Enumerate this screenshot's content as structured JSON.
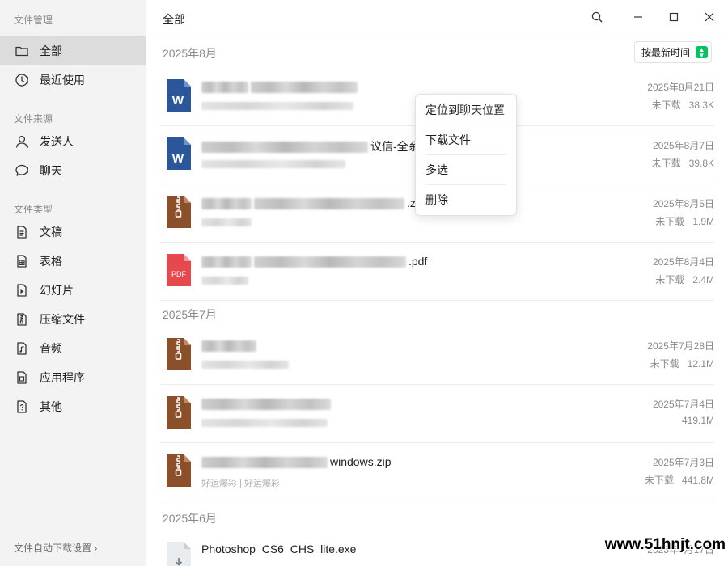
{
  "sidebar": {
    "section_manage": "文件管理",
    "section_source": "文件来源",
    "section_type": "文件类型",
    "items": [
      {
        "label": "全部",
        "icon": "folder-icon"
      },
      {
        "label": "最近使用",
        "icon": "clock-icon"
      },
      {
        "label": "发送人",
        "icon": "person-icon"
      },
      {
        "label": "聊天",
        "icon": "chat-bubble-icon"
      },
      {
        "label": "文稿",
        "icon": "document-icon"
      },
      {
        "label": "表格",
        "icon": "spreadsheet-icon"
      },
      {
        "label": "幻灯片",
        "icon": "slides-icon"
      },
      {
        "label": "压缩文件",
        "icon": "archive-icon"
      },
      {
        "label": "音频",
        "icon": "audio-icon"
      },
      {
        "label": "应用程序",
        "icon": "app-icon"
      },
      {
        "label": "其他",
        "icon": "unknown-file-icon"
      }
    ],
    "footer_link": "文件自动下载设置 ›"
  },
  "header": {
    "title": "全部",
    "search_icon": "search-icon",
    "minimize_icon": "minimize-icon",
    "maximize_icon": "maximize-icon",
    "close_icon": "close-icon"
  },
  "sort_label": "按最新时间",
  "groups": [
    {
      "label": "2025年8月"
    },
    {
      "label": "2025年7月"
    },
    {
      "label": "2025年6月"
    }
  ],
  "files": [
    {
      "type": "word",
      "name_suffix": "",
      "subtitle": "",
      "date": "2025年8月21日",
      "status": "未下载",
      "size": "38.3K"
    },
    {
      "type": "word",
      "name_suffix": "议信-全系",
      "subtitle": "",
      "date": "2025年8月7日",
      "status": "未下载",
      "size": "39.8K"
    },
    {
      "type": "zip",
      "name_suffix": ".z",
      "subtitle": "",
      "date": "2025年8月5日",
      "status": "未下载",
      "size": "1.9M"
    },
    {
      "type": "pdf",
      "name_suffix": ".pdf",
      "subtitle": "",
      "date": "2025年8月4日",
      "status": "未下载",
      "size": "2.4M"
    },
    {
      "type": "zip",
      "name_suffix": "",
      "subtitle": "",
      "date": "2025年7月28日",
      "status": "未下载",
      "size": "12.1M"
    },
    {
      "type": "zip",
      "name_suffix": "",
      "subtitle": "",
      "date": "2025年7月4日",
      "status": "",
      "size": "419.1M"
    },
    {
      "type": "zip",
      "name_suffix": "windows.zip",
      "subtitle": "好运爆彩 | 好运爆彩",
      "date": "2025年7月3日",
      "status": "未下载",
      "size": "441.8M"
    },
    {
      "type": "exe",
      "name_suffix": "Photoshop_CS6_CHS_lite.exe",
      "subtitle": "",
      "date": "2025年6月17日",
      "status": "",
      "size": ""
    }
  ],
  "pdf_badge": "PDF",
  "word_badge": "W",
  "context_menu": {
    "items": [
      "定位到聊天位置",
      "下载文件",
      "多选",
      "删除"
    ]
  },
  "watermark": "www.51hnjt.com",
  "colors": {
    "sidebar_bg": "#f3f3f3",
    "sidebar_active": "#dcdcdc",
    "word_blue": "#2b579a",
    "zip_brown": "#8b4f2a",
    "pdf_red": "#e5484d",
    "accent_green": "#07c160"
  }
}
